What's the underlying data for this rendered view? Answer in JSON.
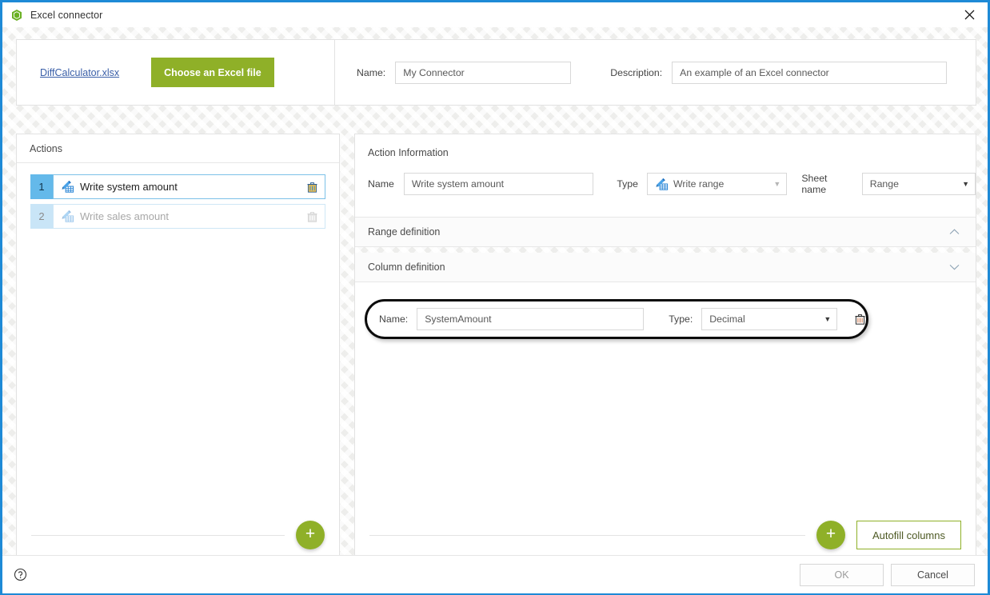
{
  "window": {
    "title": "Excel connector",
    "app_icon": "excel-connector-icon",
    "close_icon": "close-icon",
    "border_color": "#1e8ad6"
  },
  "colors": {
    "accent_green": "#8fb028",
    "accent_blue": "#64b9ea",
    "accent_blue_light": "#c9e5f7",
    "link_blue": "#3a5fa8",
    "title_border": "#1e8ad6"
  },
  "topbar": {
    "file_name": "DiffCalculator.xlsx",
    "choose_file_label": "Choose an Excel file",
    "name_label": "Name:",
    "name_value": "My Connector",
    "description_label": "Description:",
    "description_value": "An example of an Excel connector"
  },
  "actions_panel": {
    "header": "Actions",
    "add_button_label": "+",
    "add_button_icon": "plus-icon",
    "rows": [
      {
        "number": "1",
        "label": "Write system amount",
        "icon": "write-range-icon",
        "delete_icon": "trash-icon",
        "selected": true
      },
      {
        "number": "2",
        "label": "Write sales amount",
        "icon": "write-range-icon",
        "delete_icon": "trash-icon",
        "selected": false
      }
    ]
  },
  "action_information": {
    "title": "Action Information",
    "name_label": "Name",
    "name_value": "Write system amount",
    "type_label": "Type",
    "type_value": "Write range",
    "type_icon": "write-range-icon",
    "sheet_label": "Sheet name",
    "sheet_value": "Range"
  },
  "range_definition": {
    "title": "Range definition",
    "chevron": "chevron-up-icon"
  },
  "column_definition": {
    "title": "Column definition",
    "chevron": "chevron-down-icon",
    "rows": [
      {
        "name_label": "Name:",
        "name_value": "SystemAmount",
        "type_label": "Type:",
        "type_value": "Decimal",
        "delete_icon": "trash-icon",
        "highlighted": true
      }
    ],
    "add_button_label": "+",
    "add_button_icon": "plus-icon",
    "autofill_label": "Autofill columns"
  },
  "footer": {
    "help_icon": "help-icon",
    "ok_label": "OK",
    "cancel_label": "Cancel"
  }
}
